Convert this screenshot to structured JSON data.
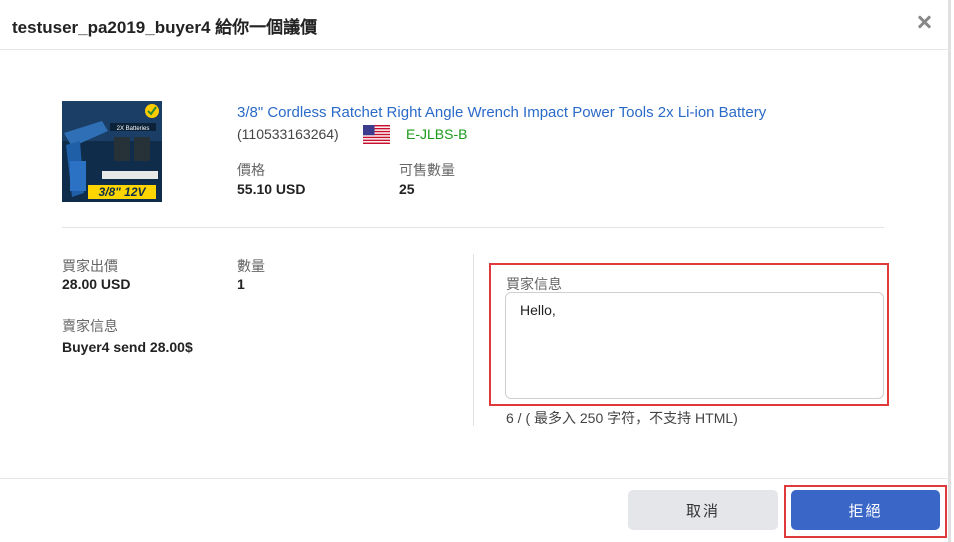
{
  "dialog": {
    "title": "testuser_pa2019_buyer4 給你一個議價"
  },
  "product": {
    "title": "3/8\" Cordless Ratchet Right Angle Wrench Impact Power Tools 2x Li-ion Battery",
    "item_id": "(110533163264)",
    "country_flag": "us-flag-icon",
    "seller": "E-JLBS-B",
    "image_text_top": "2X Batteries",
    "image_text_bottom": "3/8\" 12V",
    "price_label": "價格",
    "price_value": "55.10 USD",
    "qty_label": "可售數量",
    "qty_value": "25"
  },
  "offer": {
    "buyer_price_label": "買家出價",
    "buyer_price_value": "28.00 USD",
    "quantity_label": "數量",
    "quantity_value": "1",
    "seller_msg_label": "賣家信息",
    "seller_msg_value": "Buyer4 send 28.00$"
  },
  "buyer_message": {
    "label": "買家信息",
    "value": "Hello,",
    "counter": "6 / ( 最多入 250 字符，不支持 HTML)"
  },
  "buttons": {
    "cancel": "取消",
    "reject": "拒絕"
  },
  "colors": {
    "link": "#2a6ac8",
    "seller": "#1a9a1a",
    "primary": "#3a66c8",
    "highlight": "#e0393c"
  }
}
